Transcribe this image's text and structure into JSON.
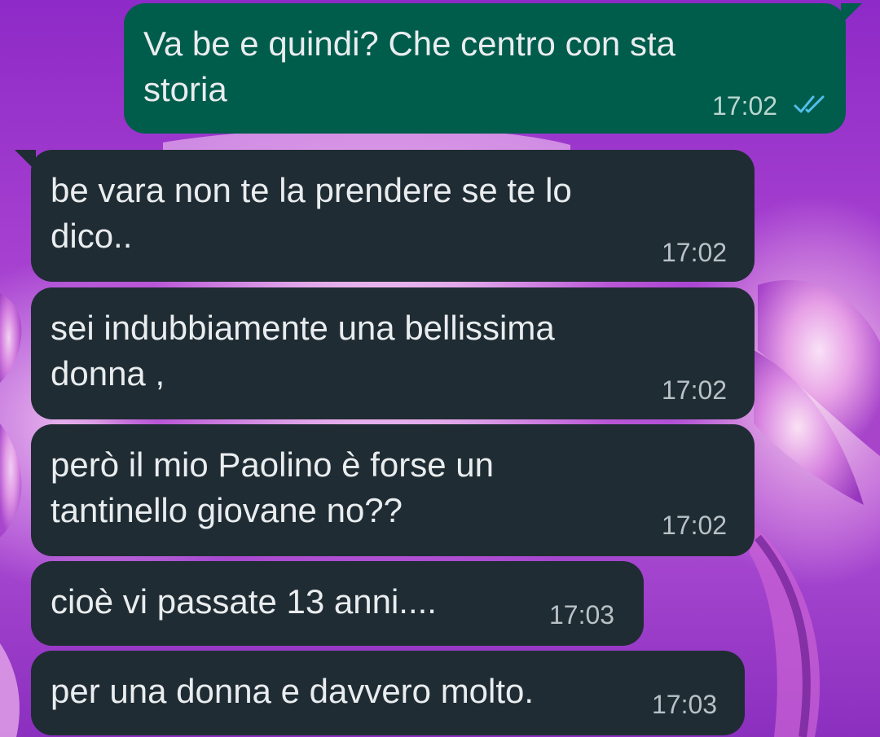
{
  "theme": {
    "incoming_bubble": "#202c33",
    "outgoing_bubble": "#005c4b",
    "text_color": "#e9edef",
    "read_ticks_color": "#53bdeb"
  },
  "messages": [
    {
      "direction": "outgoing",
      "text": "Va be e quindi? Che centro con sta\nstoria",
      "time": "17:02",
      "status_icon": "double-check-read-icon"
    },
    {
      "direction": "incoming",
      "text": "be vara non te la prendere se te lo\ndico..",
      "time": "17:02"
    },
    {
      "direction": "incoming",
      "text": "sei indubbiamente una bellissima\ndonna ,",
      "time": "17:02"
    },
    {
      "direction": "incoming",
      "text": "però il mio Paolino è forse un\ntantinello giovane no??",
      "time": "17:02"
    },
    {
      "direction": "incoming",
      "text": "cioè vi passate 13 anni....",
      "time": "17:03"
    },
    {
      "direction": "incoming",
      "text": "per una donna e davvero molto.",
      "time": "17:03"
    }
  ]
}
